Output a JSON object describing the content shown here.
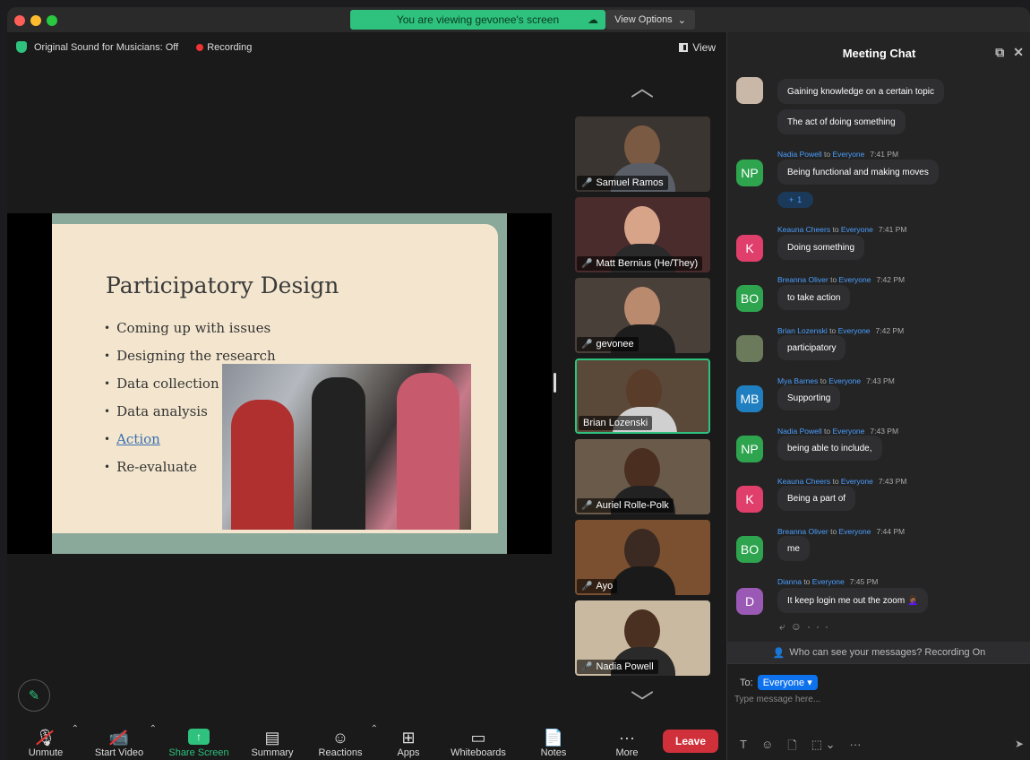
{
  "banner": {
    "text": "You are viewing gevonee's screen",
    "view_options": "View Options"
  },
  "topbar": {
    "sound": "Original Sound for Musicians: Off",
    "recording": "Recording",
    "view": "View"
  },
  "slide": {
    "title": "Participatory Design",
    "bullets": [
      "Coming up with issues",
      "Designing the research",
      "Data collection",
      "Data analysis",
      "Action",
      "Re-evaluate"
    ]
  },
  "participants": [
    {
      "name": "Samuel Ramos",
      "muted": true
    },
    {
      "name": "Matt Bernius (He/They)",
      "muted": true
    },
    {
      "name": "gevonee",
      "muted": true
    },
    {
      "name": "Brian Lozenski",
      "muted": false
    },
    {
      "name": "Auriel Rolle-Polk",
      "muted": true
    },
    {
      "name": "Ayo",
      "muted": true
    },
    {
      "name": "Nadia Powell",
      "muted": true
    }
  ],
  "toolbar": {
    "unmute": "Unmute",
    "start_video": "Start Video",
    "share_screen": "Share Screen",
    "summary": "Summary",
    "reactions": "Reactions",
    "apps": "Apps",
    "whiteboards": "Whiteboards",
    "notes": "Notes",
    "more": "More",
    "leave": "Leave"
  },
  "chat": {
    "title": "Meeting Chat",
    "messages": [
      {
        "text": "Gaining knowledge on a certain topic"
      },
      {
        "text": "The act of doing something"
      },
      {
        "from": "Nadia Powell",
        "to": "to",
        "recipient": "Everyone",
        "time": "7:41 PM",
        "initials": "NP",
        "text": "Being functional and making moves",
        "reaction": "1"
      },
      {
        "from": "Keauna Cheers",
        "to": "to",
        "recipient": "Everyone",
        "time": "7:41 PM",
        "initials": "K",
        "text": "Doing something"
      },
      {
        "from": "Breanna Oliver",
        "to": "to",
        "recipient": "Everyone",
        "time": "7:42 PM",
        "initials": "BO",
        "text": "to take action"
      },
      {
        "from": "Brian Lozenski",
        "to": "to",
        "recipient": "Everyone",
        "time": "7:42 PM",
        "initials": "",
        "text": "participatory"
      },
      {
        "from": "Mya Barnes",
        "to": "to",
        "recipient": "Everyone",
        "time": "7:43 PM",
        "initials": "MB",
        "text": "Supporting"
      },
      {
        "from": "Nadia Powell",
        "to": "to",
        "recipient": "Everyone",
        "time": "7:43 PM",
        "initials": "NP",
        "text": "being able to include,"
      },
      {
        "from": "Keauna Cheers",
        "to": "to",
        "recipient": "Everyone",
        "time": "7:43 PM",
        "initials": "K",
        "text": "Being a part of"
      },
      {
        "from": "Breanna Oliver",
        "to": "to",
        "recipient": "Everyone",
        "time": "7:44 PM",
        "initials": "BO",
        "text": "me"
      },
      {
        "from": "Dianna",
        "to": "to",
        "recipient": "Everyone",
        "time": "7:45 PM",
        "initials": "D",
        "text": "It keep login me out the zoom 🤦🏾‍♀️"
      }
    ],
    "privacy": "Who can see your messages? Recording On",
    "to_label": "To:",
    "to_value": "Everyone",
    "placeholder": "Type message here..."
  },
  "colors": {
    "accent_green": "#2ec27e",
    "zoom_blue": "#0e72ed",
    "leave_red": "#d0303a"
  }
}
